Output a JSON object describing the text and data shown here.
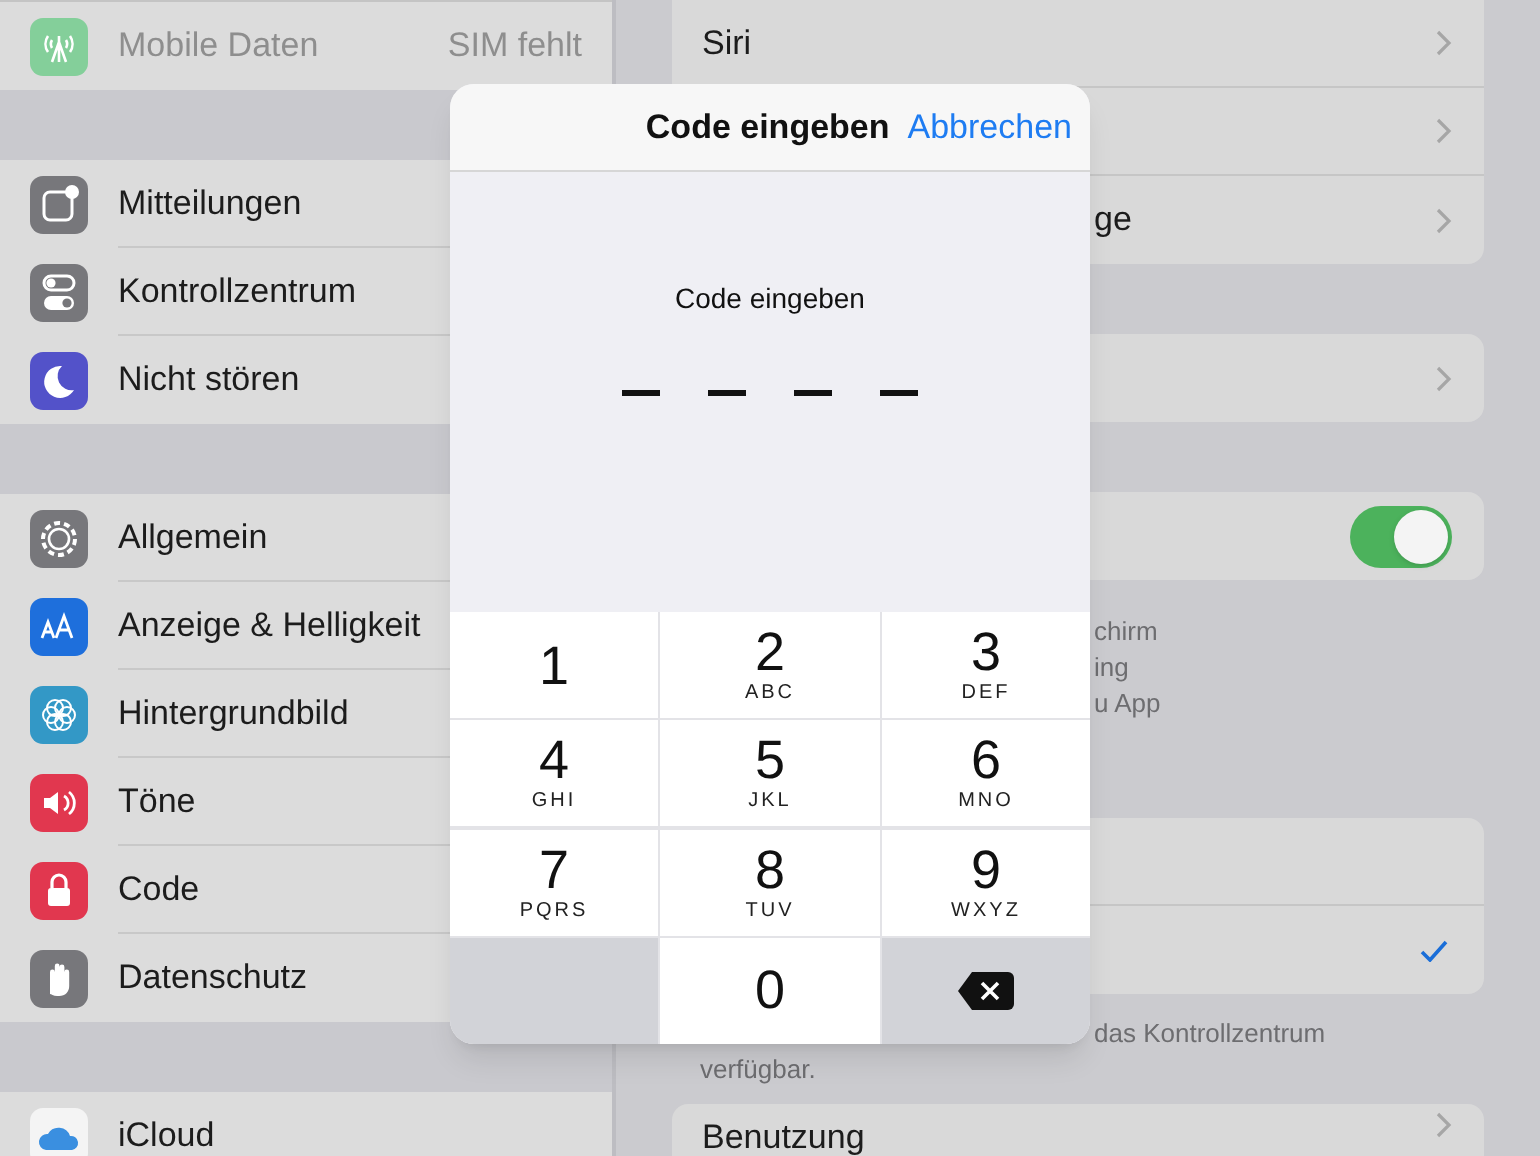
{
  "sidebar": {
    "groups": [
      {
        "items": [
          {
            "label": "Mobile Daten",
            "value": "SIM fehlt",
            "disabled": true
          }
        ]
      },
      {
        "items": [
          {
            "label": "Mitteilungen",
            "disabled": false
          },
          {
            "label": "Kontrollzentrum",
            "disabled": false
          },
          {
            "label": "Nicht stören",
            "disabled": false
          }
        ]
      },
      {
        "items": [
          {
            "label": "Allgemein",
            "disabled": false
          },
          {
            "label": "Anzeige & Helligkeit",
            "disabled": false
          },
          {
            "label": "Hintergrundbild",
            "disabled": false
          },
          {
            "label": "Töne",
            "disabled": false
          },
          {
            "label": "Code",
            "disabled": false
          },
          {
            "label": "Datenschutz",
            "disabled": false
          }
        ]
      },
      {
        "items": [
          {
            "label": "iCloud",
            "disabled": false
          }
        ]
      }
    ]
  },
  "detail": {
    "cards": [
      {
        "rows": [
          {
            "kind": "link",
            "label": "Siri"
          },
          {
            "kind": "link"
          },
          {
            "kind": "link",
            "label": "ge",
            "partial": true
          }
        ]
      },
      {
        "rows": [
          {
            "kind": "link"
          }
        ]
      },
      {
        "rows": [
          {
            "kind": "switch",
            "on": true
          }
        ],
        "footer": [
          {
            "text": "chirm",
            "partial": true
          },
          {
            "text": "ing",
            "partial": true
          },
          {
            "text": "u App",
            "partial": true
          }
        ]
      },
      {
        "rows": [
          {
            "kind": "option",
            "selected": false
          },
          {
            "kind": "option",
            "selected": true
          }
        ],
        "footer": [
          {
            "text": "das Kontrollzentrum",
            "partial": true
          },
          {
            "text": "verfügbar.",
            "partial": false
          }
        ]
      },
      {
        "rows": [
          {
            "kind": "link",
            "label": "Benutzung"
          }
        ]
      }
    ]
  },
  "dialog": {
    "title": "Code eingeben",
    "cancel": "Abbrechen",
    "prompt": "Code eingeben",
    "slots": [
      {
        "filled": false
      },
      {
        "filled": false
      },
      {
        "filled": false
      },
      {
        "filled": false
      }
    ],
    "keys": [
      {
        "kind": "digit",
        "digit": "1"
      },
      {
        "kind": "digit",
        "digit": "2",
        "letters": "ABC"
      },
      {
        "kind": "digit",
        "digit": "3",
        "letters": "DEF"
      },
      {
        "kind": "digit",
        "digit": "4",
        "letters": "GHI"
      },
      {
        "kind": "digit",
        "digit": "5",
        "letters": "JKL"
      },
      {
        "kind": "digit",
        "digit": "6",
        "letters": "MNO"
      },
      {
        "kind": "digit",
        "digit": "7",
        "letters": "PQRS"
      },
      {
        "kind": "digit",
        "digit": "8",
        "letters": "TUV"
      },
      {
        "kind": "digit",
        "digit": "9",
        "letters": "WXYZ"
      },
      {
        "kind": "blank"
      },
      {
        "kind": "digit",
        "digit": "0"
      },
      {
        "kind": "delete"
      }
    ]
  }
}
